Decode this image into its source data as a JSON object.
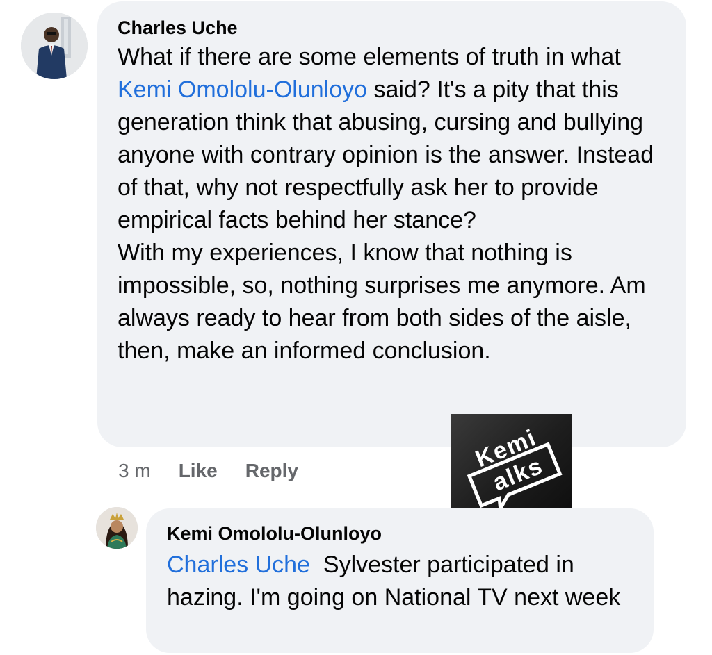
{
  "comment1": {
    "author": "Charles Uche",
    "text_before_mention": "What if there are some elements of truth in what ",
    "mention": "Kemi Omololu-Olunloyo",
    "paragraph1_after": " said? It's a pity that this generation think that abusing, cursing and bullying anyone with contrary opinion is the answer. Instead of that, why not respectfully ask her to provide empirical facts behind her stance?",
    "paragraph2": "With my experiences, I know that nothing is impossible, so, nothing surprises me anymore. Am always ready to hear from both sides of the aisle, then, make an informed conclusion.",
    "time": "3 m",
    "like_label": "Like",
    "reply_label": "Reply"
  },
  "reply1": {
    "author": "Kemi Omololu-Olunloyo",
    "mention": "Charles Uche",
    "text": "Sylvester participated in hazing. I'm going on National TV next week"
  },
  "watermark": {
    "line1": "Kemi",
    "line2": "alks"
  },
  "colors": {
    "bubble": "#f0f2f5",
    "mention": "#216fdb",
    "meta": "#65676b"
  }
}
